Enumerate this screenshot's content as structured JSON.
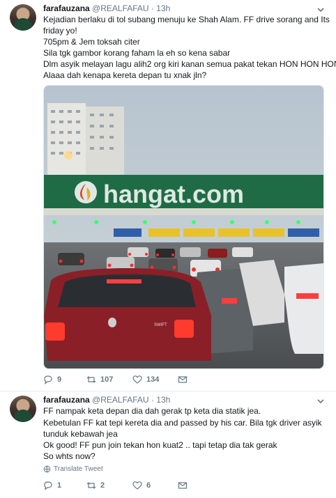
{
  "tweets": [
    {
      "author_name": "farafauzana",
      "handle": "@REALFAFAU",
      "separator": "·",
      "time": "13h",
      "lines": [
        "Kejadian berlaku di tol subang menuju ke Shah Alam. FF drive sorang and Its",
        "friday yo!",
        "705pm & Jem toksah citer",
        "Sila tgk gambor korang faham la eh so kena sabar",
        "Dlm asyik melayan lagu alih2 org kiri kanan semua pakat tekan HON HON HON",
        "Alaaa dah kenapa kereta depan tu xnak jln?"
      ],
      "media": {
        "watermark": "hangat.com",
        "car_badge": "SWIFT"
      },
      "actions": {
        "replies": "9",
        "retweets": "107",
        "likes": "134"
      }
    },
    {
      "author_name": "farafauzana",
      "handle": "@REALFAFAU",
      "separator": "·",
      "time": "13h",
      "lines": [
        "FF nampak keta depan dia dah gerak tp keta dia statik jea.",
        "Kebetulan FF kat tepi kereta dia and passed by his car. Bila tgk driver asyik",
        "tunduk kebawah jea",
        "Ok good! FF pun join tekan hon kuat2 .. tapi tetap dia tak gerak",
        "So whts now?"
      ],
      "translate": "Translate Tweet",
      "actions": {
        "replies": "1",
        "retweets": "2",
        "likes": "6"
      }
    }
  ],
  "colors": {
    "text": "#14171a",
    "secondary": "#657786",
    "divider": "#e6ecf0"
  }
}
